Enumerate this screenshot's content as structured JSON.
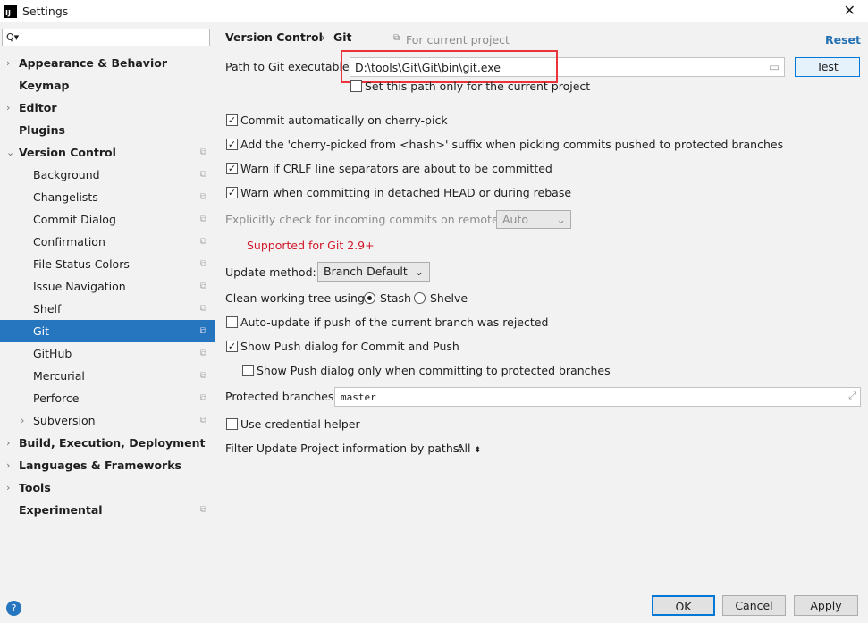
{
  "window": {
    "title": "Settings",
    "logo": "IJ"
  },
  "sidebar": {
    "search_placeholder": "Q▾",
    "items": [
      {
        "label": "Appearance & Behavior",
        "level": 0,
        "arrow": "›"
      },
      {
        "label": "Keymap",
        "level": 0
      },
      {
        "label": "Editor",
        "level": 0,
        "arrow": "›"
      },
      {
        "label": "Plugins",
        "level": 0
      },
      {
        "label": "Version Control",
        "level": 0,
        "arrow": "⌄",
        "copy": true
      },
      {
        "label": "Background",
        "level": 1,
        "copy": true
      },
      {
        "label": "Changelists",
        "level": 1,
        "copy": true
      },
      {
        "label": "Commit Dialog",
        "level": 1,
        "copy": true
      },
      {
        "label": "Confirmation",
        "level": 1,
        "copy": true
      },
      {
        "label": "File Status Colors",
        "level": 1,
        "copy": true
      },
      {
        "label": "Issue Navigation",
        "level": 1,
        "copy": true
      },
      {
        "label": "Shelf",
        "level": 1,
        "copy": true
      },
      {
        "label": "Git",
        "level": 1,
        "copy": true,
        "selected": true
      },
      {
        "label": "GitHub",
        "level": 1,
        "copy": true
      },
      {
        "label": "Mercurial",
        "level": 1,
        "copy": true
      },
      {
        "label": "Perforce",
        "level": 1,
        "copy": true
      },
      {
        "label": "Subversion",
        "level": 1,
        "arrow": "›",
        "copy": true
      },
      {
        "label": "Build, Execution, Deployment",
        "level": 0,
        "arrow": "›"
      },
      {
        "label": "Languages & Frameworks",
        "level": 0,
        "arrow": "›"
      },
      {
        "label": "Tools",
        "level": 0,
        "arrow": "›"
      },
      {
        "label": "Experimental",
        "level": 0,
        "copy": true
      }
    ]
  },
  "header": {
    "crumb1": "Version Control",
    "sep": "›",
    "crumb2": "Git",
    "scope": "For current project",
    "reset": "Reset"
  },
  "path": {
    "label": "Path to Git executable:",
    "value": "D:\\tools\\Git\\Git\\bin\\git.exe",
    "test": "Test",
    "project_only": "Set this path only for the current project",
    "project_only_checked": false
  },
  "options": [
    {
      "label": "Commit automatically on cherry-pick",
      "checked": true
    },
    {
      "label": "Add the 'cherry-picked from <hash>' suffix when picking commits pushed to protected branches",
      "checked": true
    },
    {
      "label": "Warn if CRLF line separators are about to be committed",
      "checked": true
    },
    {
      "label": "Warn when committing in detached HEAD or during rebase",
      "checked": true
    }
  ],
  "incoming": {
    "label": "Explicitly check for incoming commits on remotes:",
    "value": "Auto",
    "note": "Supported for Git 2.9+"
  },
  "update": {
    "label": "Update method:",
    "value": "Branch Default"
  },
  "clean": {
    "label": "Clean working tree using:",
    "stash": "Stash",
    "shelve": "Shelve",
    "selected": "Stash"
  },
  "options2": [
    {
      "label": "Auto-update if push of the current branch was rejected",
      "checked": false
    },
    {
      "label": "Show Push dialog for Commit and Push",
      "checked": true
    },
    {
      "label": "Show Push dialog only when committing to protected branches",
      "checked": false
    }
  ],
  "protected": {
    "label": "Protected branches:",
    "value": "master"
  },
  "credential": {
    "label": "Use credential helper",
    "checked": false
  },
  "filter": {
    "label": "Filter Update Project information by paths:",
    "value": "All"
  },
  "footer": {
    "help": "?",
    "ok": "OK",
    "cancel": "Cancel",
    "apply": "Apply"
  },
  "colors": {
    "accent": "#2675bf",
    "link": "#2470b3",
    "error": "#d0182a",
    "highlight_box": "#e8343a"
  }
}
